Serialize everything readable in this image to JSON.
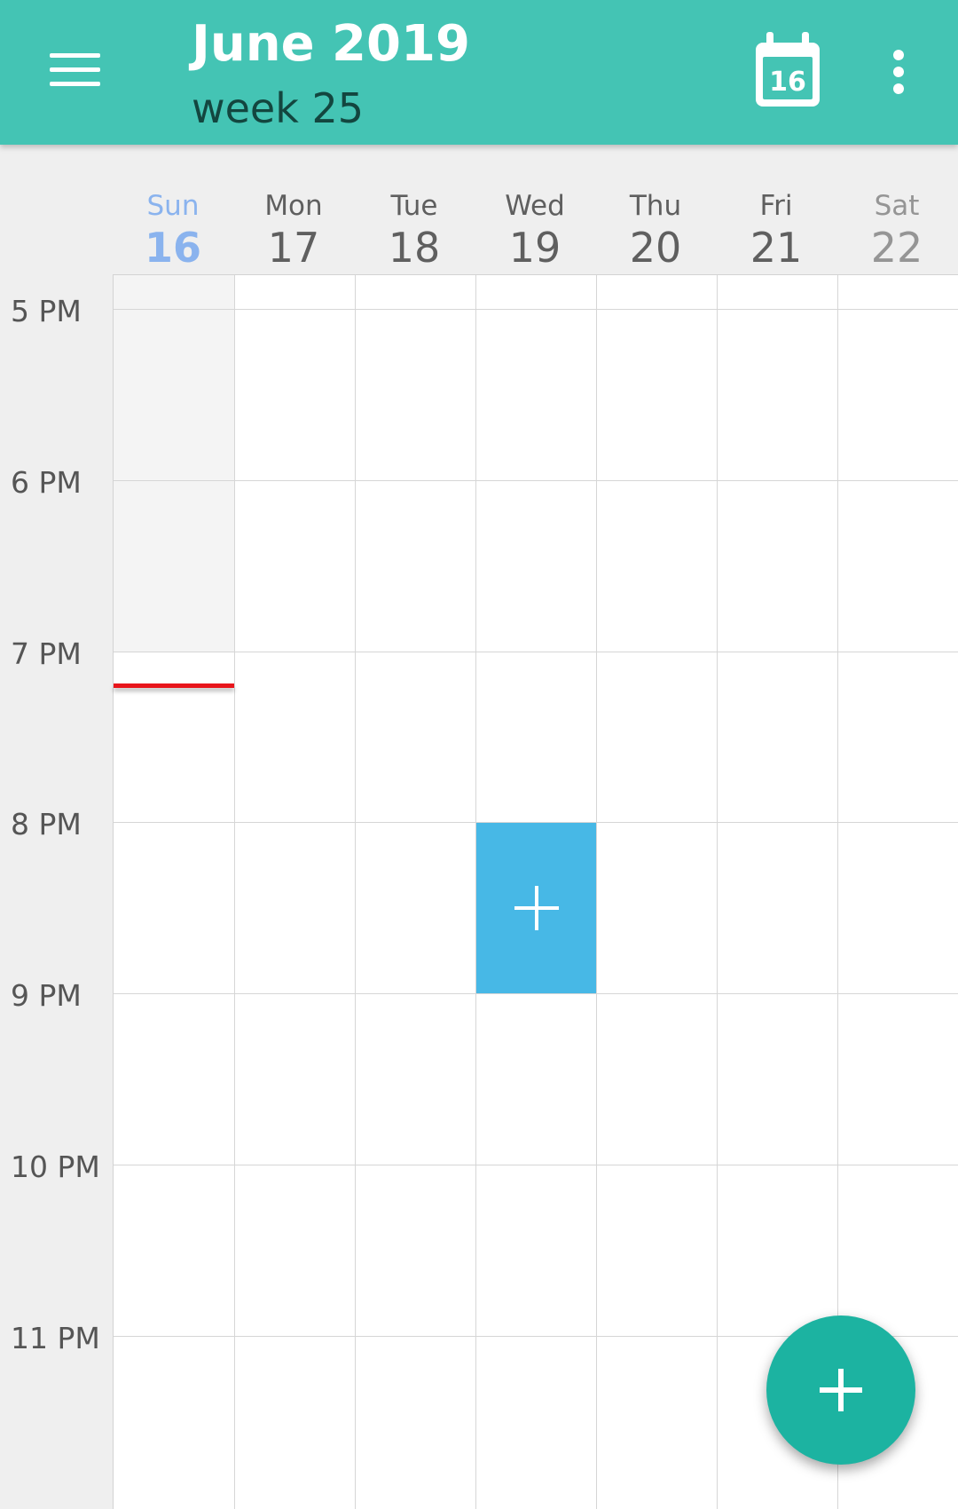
{
  "header": {
    "title": "June 2019",
    "subtitle": "week 25",
    "today_number": "16",
    "menu_icon": "hamburger-menu-icon",
    "today_icon": "calendar-today-icon",
    "more_icon": "more-vert-icon",
    "color": "#44c4b4"
  },
  "days": [
    {
      "name": "Sun",
      "number": "16",
      "today": true
    },
    {
      "name": "Mon",
      "number": "17"
    },
    {
      "name": "Tue",
      "number": "18"
    },
    {
      "name": "Wed",
      "number": "19"
    },
    {
      "name": "Thu",
      "number": "20"
    },
    {
      "name": "Fri",
      "number": "21"
    },
    {
      "name": "Sat",
      "number": "22"
    }
  ],
  "hours": [
    "5 PM",
    "6 PM",
    "7 PM",
    "8 PM",
    "9 PM",
    "10 PM",
    "11 PM"
  ],
  "colors": {
    "today": "#8ab3ee",
    "now_line": "#e8151b",
    "new_event": "#47b8e6",
    "fab": "#1cb3a1"
  },
  "new_event_slot": {
    "day": "Wed",
    "start": "8 PM",
    "end": "9 PM",
    "icon": "plus-icon"
  },
  "fab": {
    "icon": "plus-icon"
  }
}
